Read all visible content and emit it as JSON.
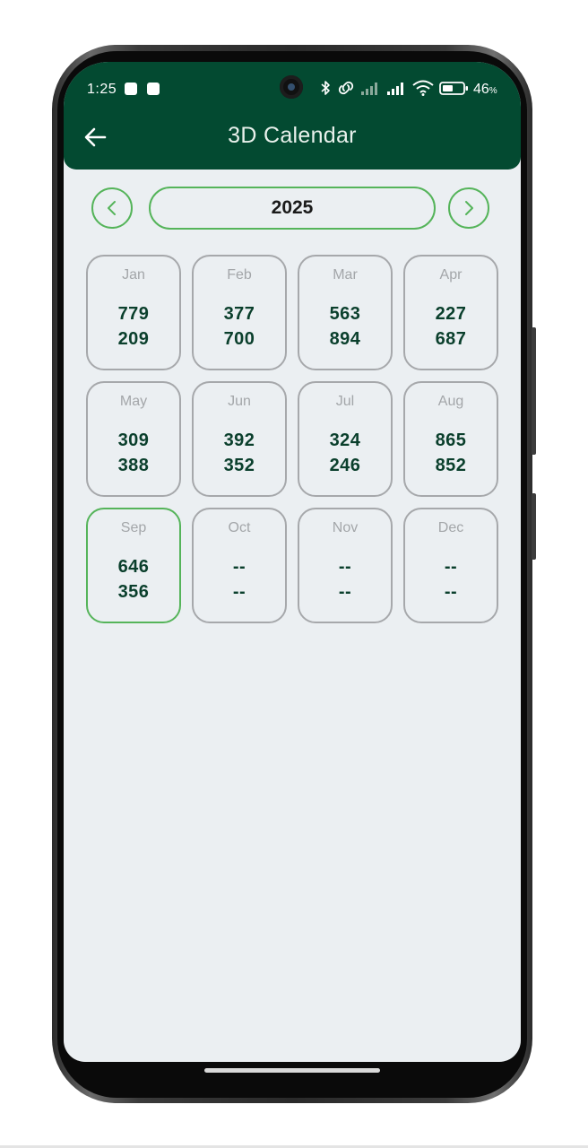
{
  "status_bar": {
    "time": "1:25",
    "battery": "46",
    "battery_unit": "%",
    "icons": [
      "bluetooth-icon",
      "link-icon",
      "signal-icon",
      "signal-icon",
      "wifi-icon",
      "battery-icon"
    ]
  },
  "header": {
    "title": "3D Calendar",
    "back_icon": "arrow-left-icon"
  },
  "year_nav": {
    "year": "2025",
    "prev_icon": "chevron-left-icon",
    "next_icon": "chevron-right-icon"
  },
  "months": [
    {
      "name": "Jan",
      "v1": "779",
      "v2": "209"
    },
    {
      "name": "Feb",
      "v1": "377",
      "v2": "700"
    },
    {
      "name": "Mar",
      "v1": "563",
      "v2": "894"
    },
    {
      "name": "Apr",
      "v1": "227",
      "v2": "687"
    },
    {
      "name": "May",
      "v1": "309",
      "v2": "388"
    },
    {
      "name": "Jun",
      "v1": "392",
      "v2": "352"
    },
    {
      "name": "Jul",
      "v1": "324",
      "v2": "246"
    },
    {
      "name": "Aug",
      "v1": "865",
      "v2": "852"
    },
    {
      "name": "Sep",
      "v1": "646",
      "v2": "356",
      "active": true
    },
    {
      "name": "Oct",
      "v1": "--",
      "v2": "--"
    },
    {
      "name": "Nov",
      "v1": "--",
      "v2": "--"
    },
    {
      "name": "Dec",
      "v1": "--",
      "v2": "--"
    }
  ],
  "colors": {
    "header_bg": "#034a31",
    "accent_green": "#55b45a",
    "value_text": "#0a3f2c",
    "screen_bg": "#ebeff2",
    "card_border": "#a6a8ab"
  }
}
